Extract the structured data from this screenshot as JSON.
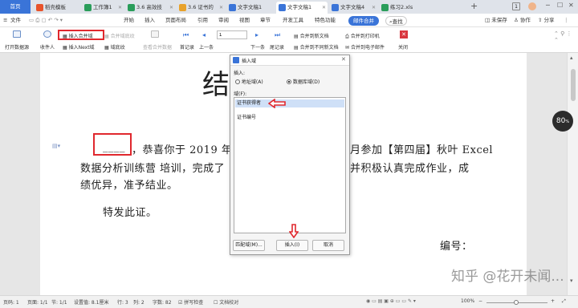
{
  "tabs": {
    "home": "首页",
    "items": [
      "稻壳模板",
      "工作簿1",
      "3.6 高效技",
      "3.6 证书的",
      "文字文稿1",
      "文字文稿1",
      "文字文稿4",
      "练习2.xls"
    ],
    "new_tab": "+",
    "win_badge": "1"
  },
  "menubar": {
    "file": "文件",
    "items": [
      "开始",
      "插入",
      "页面布局",
      "引用",
      "审阅",
      "视图",
      "章节",
      "开发工具",
      "特色功能"
    ],
    "mail_merge": "邮件合并",
    "search": "查找",
    "unsaved": "未保存",
    "collab": "协作",
    "share": "分享"
  },
  "toolbar": {
    "open_source": "打开数据源",
    "recipients": "收件人",
    "insert_merge_field": "插入合并域",
    "merge_field_shading": "合并域底纹",
    "insert_next_field": "插入Next域",
    "field_shading": "域底纹",
    "view_merge_data": "查看合并数据",
    "first_record": "首记录",
    "prev_record": "上一条",
    "record_value": "1",
    "next_record": "下一条",
    "last_record": "尾记录",
    "merge_new_doc": "合并到新文档",
    "merge_diff_docs": "合并到不同新文档",
    "merge_printer": "合并到打印机",
    "merge_email": "合并到电子邮件",
    "close": "关闭"
  },
  "document": {
    "title_char": "结",
    "blank": "____",
    "line1_a": "，恭喜你于 2019 年 5",
    "line1_b": "月参加【第四届】秋叶 Excel",
    "line2_a": "数据分析训练营 培训，完成了",
    "line2_b": "并积极认真完成作业，成",
    "line3": "绩优异，准予结业。",
    "line4": "特发此证。",
    "serial_label": "编号："
  },
  "dialog": {
    "title": "插入域",
    "insert_label": "插入:",
    "radio_address": "地址域(A)",
    "radio_database": "数据库域(D)",
    "fields_label": "域(F):",
    "fields": [
      "证书获得者",
      "证书编号"
    ],
    "match_button": "匹配域(M)...",
    "insert_button": "插入(I)",
    "cancel_button": "取消"
  },
  "sidebar": {
    "zoom_badge": "80",
    "zoom_unit": "%"
  },
  "statusbar": {
    "page_num": "页码: 1",
    "pages": "页面: 1/1",
    "section": "节: 1/1",
    "setting": "设置值: 8.1厘米",
    "row": "行: 3",
    "col": "列: 2",
    "word_count": "字数: 82",
    "spell_check": "拼写检查",
    "doc_check": "文档校对",
    "zoom": "100%"
  },
  "watermark": "知乎 @花开未闻...",
  "colors": {
    "accent": "#3a74d8",
    "highlight": "#e0282e",
    "selected": "#cfe0f7"
  }
}
